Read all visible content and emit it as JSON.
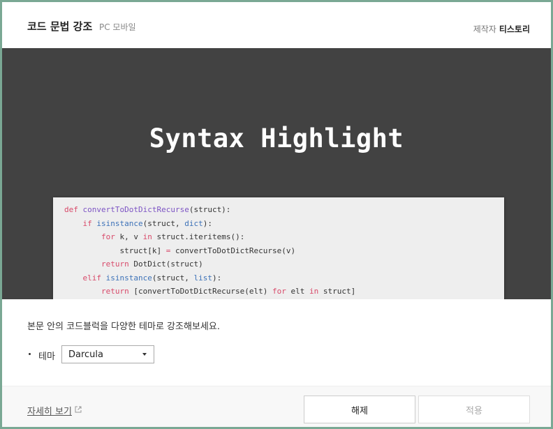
{
  "header": {
    "title": "코드 문법 강조",
    "platforms": "PC 모바일",
    "maker_label": "제작자",
    "maker_name": "티스토리"
  },
  "preview": {
    "hero_text": "Syntax Highlight",
    "code_lines": [
      "def convertToDotDictRecurse(struct):",
      "    if isinstance(struct, dict):",
      "        for k, v in struct.iteritems():",
      "            struct[k] = convertToDotDictRecurse(v)",
      "        return DotDict(struct)",
      "    elif isinstance(struct, list):",
      "        return [convertToDotDictRecurse(elt) for elt in struct]"
    ]
  },
  "body": {
    "description": "본문 안의 코드블럭을 다양한 테마로 강조해보세요.",
    "theme_label": "테마",
    "theme_selected": "Darcula"
  },
  "footer": {
    "more_link": "자세히 보기",
    "release_button": "해제",
    "apply_button": "적용"
  },
  "colors": {
    "frame_border": "#7aa894",
    "preview_bg": "#424242",
    "code_bg": "#eeeeee",
    "keyword": "#d84a6a",
    "function_name": "#7d54c4",
    "builtin": "#3d72b8"
  },
  "icons": {
    "external_link": "external-link-icon",
    "dropdown": "chevron-down-icon"
  }
}
